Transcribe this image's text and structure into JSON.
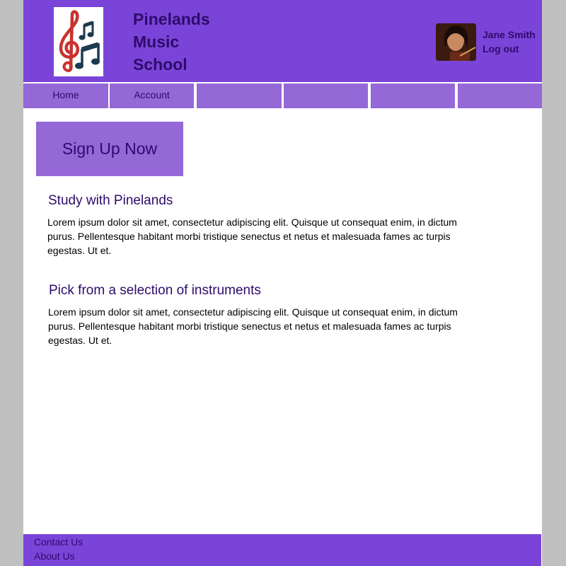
{
  "header": {
    "title_lines": [
      "Pinelands",
      "Music",
      "School"
    ],
    "user_name": "Jane Smith",
    "logout_label": "Log out"
  },
  "nav": {
    "items": [
      {
        "label": "Home"
      },
      {
        "label": "Account"
      },
      {
        "label": ""
      },
      {
        "label": ""
      },
      {
        "label": ""
      },
      {
        "label": ""
      }
    ]
  },
  "main": {
    "signup_label": "Sign Up Now",
    "sections": [
      {
        "heading": "Study with Pinelands",
        "body": "Lorem ipsum dolor sit amet, consectetur adipiscing elit. Quisque ut consequat enim, in dictum purus. Pellentesque habitant morbi tristique senectus et netus et malesuada fames ac turpis egestas. Ut et."
      },
      {
        "heading": "Pick from a selection of instruments",
        "body": "Lorem ipsum dolor sit amet, consectetur adipiscing elit. Quisque ut consequat enim, in dictum purus. Pellentesque habitant morbi tristique senectus et netus et malesuada fames ac turpis egestas. Ut et."
      }
    ]
  },
  "footer": {
    "contact_label": "Contact Us",
    "about_label": "About Us"
  },
  "colors": {
    "brand": "#7b44d8",
    "nav_bg": "#9568d8",
    "text_dark": "#2d0b6b"
  }
}
